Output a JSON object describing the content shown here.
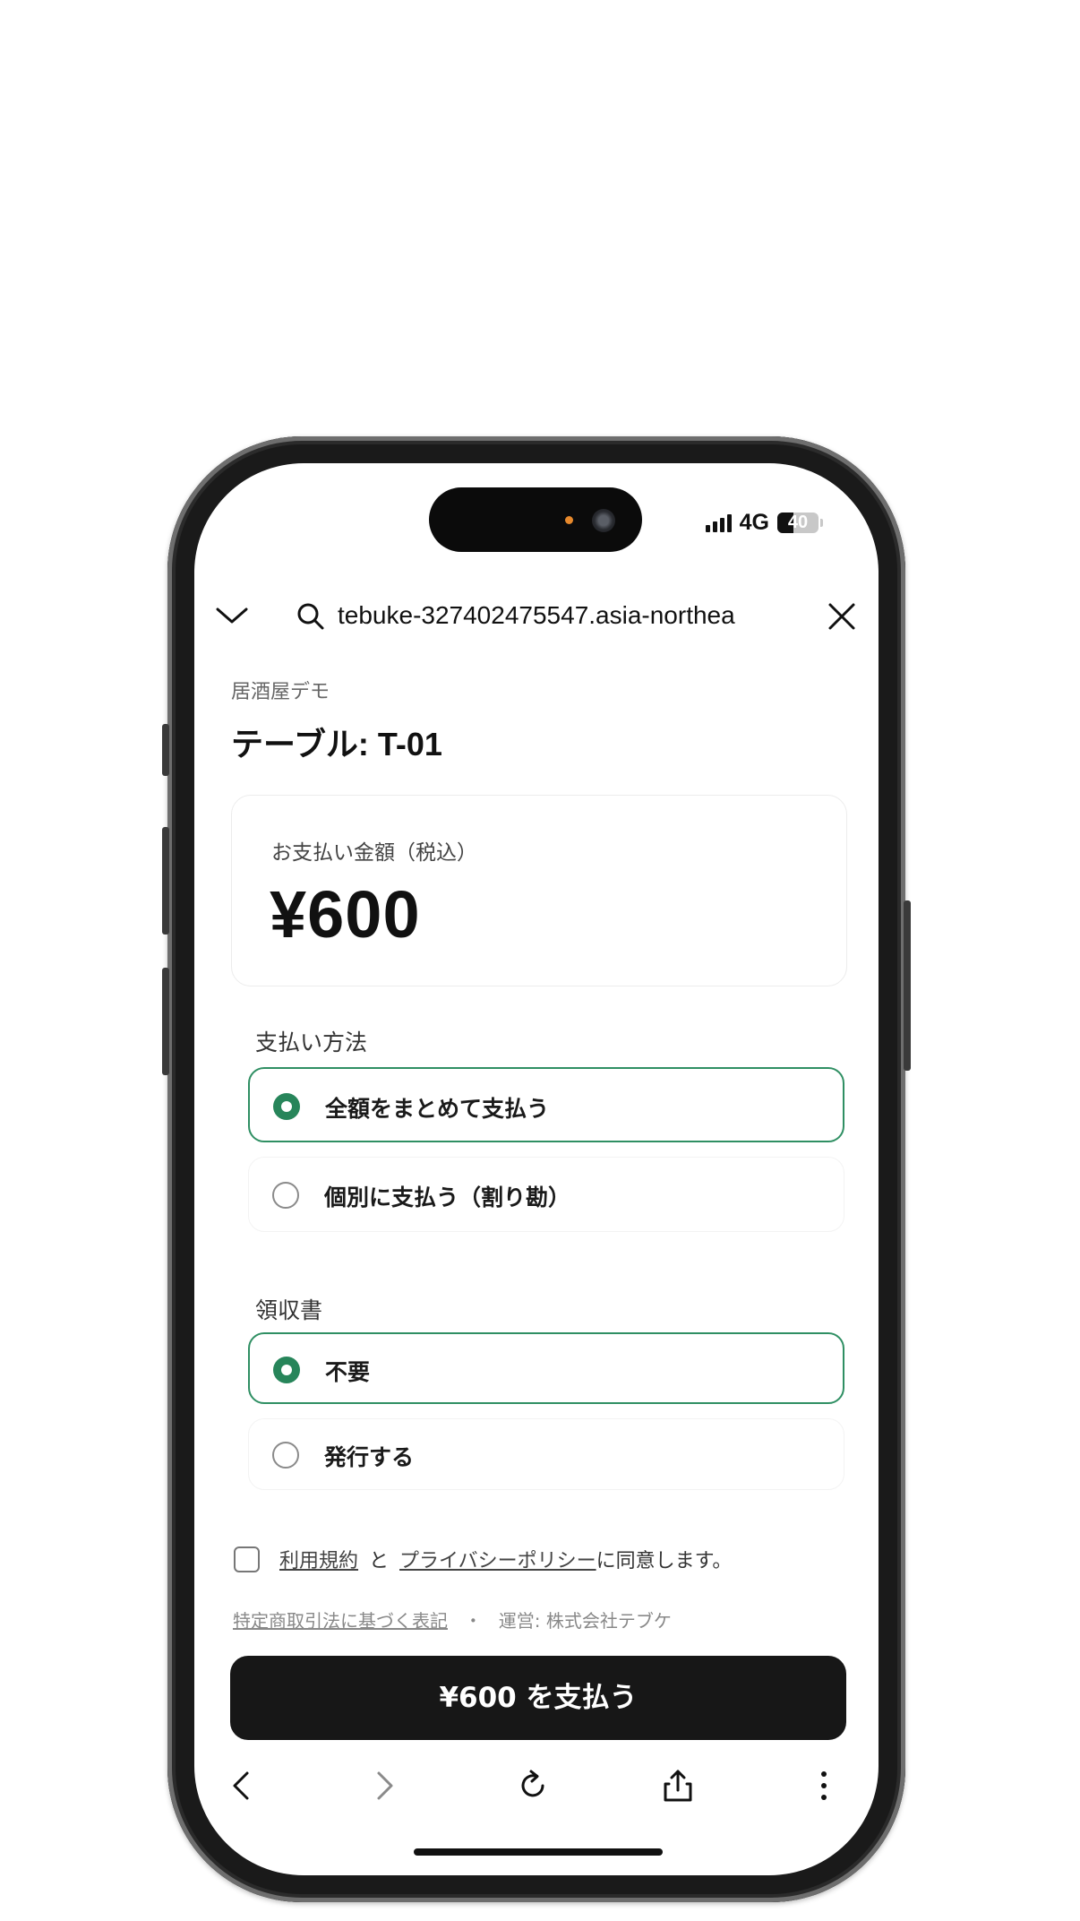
{
  "status_bar": {
    "network": "4G",
    "battery": "40",
    "battery_fraction": 0.4,
    "signal_bars": 4
  },
  "browser": {
    "url": "tebuke-327402475547.asia-northea",
    "icons": [
      "chevron-down-icon",
      "search-icon",
      "close-icon"
    ],
    "toolbar_icons": [
      "back-icon",
      "forward-icon",
      "reload-icon",
      "share-icon",
      "more-icon"
    ]
  },
  "page": {
    "store_name": "居酒屋デモ",
    "table_label": "テーブル: T-01",
    "amount_label": "お支払い金額（税込）",
    "amount": "¥600",
    "payment_method": {
      "title": "支払い方法",
      "options": [
        {
          "label": "全額をまとめて支払う",
          "selected": true
        },
        {
          "label": "個別に支払う（割り勘）",
          "selected": false
        }
      ]
    },
    "receipt": {
      "title": "領収書",
      "options": [
        {
          "label": "不要",
          "selected": true
        },
        {
          "label": "発行する",
          "selected": false
        }
      ]
    },
    "consent": {
      "checked": false,
      "terms_link": "利用規約",
      "and": "と",
      "privacy_link": "プライバシーポリシー",
      "suffix": "に同意します。"
    },
    "legal": {
      "link": "特定商取引法に基づく表記",
      "separator": "・",
      "operator": "運営: 株式会社テブケ"
    },
    "pay_button": "¥600 を支払う"
  },
  "colors": {
    "accent": "#2f8f63",
    "button_bg": "#171717"
  }
}
